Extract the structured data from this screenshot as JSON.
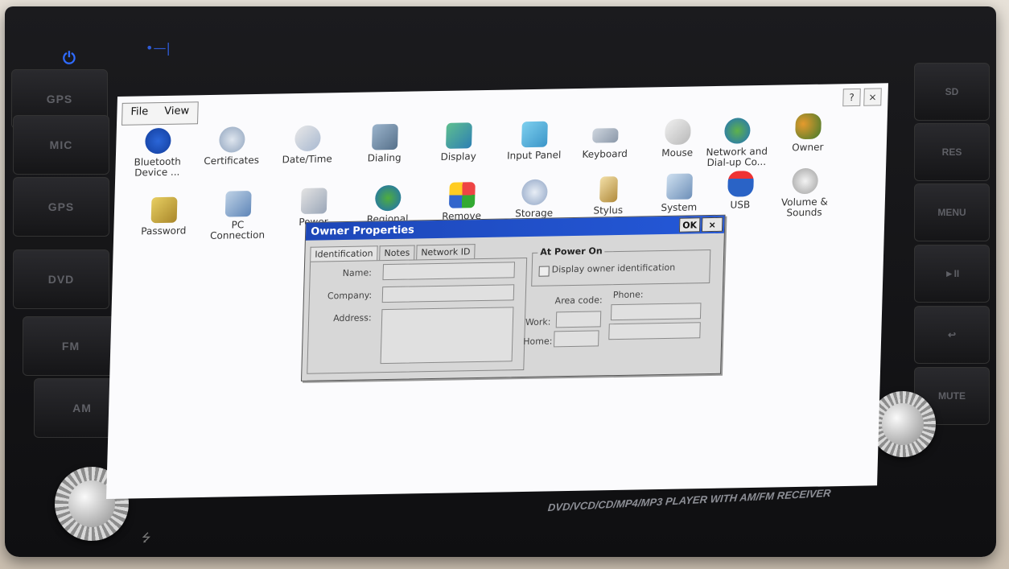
{
  "device": {
    "left_buttons": [
      "GPS",
      "MIC",
      "GPS",
      "DVD",
      "FM",
      "AM"
    ],
    "right_buttons": [
      "SD",
      "RES",
      "MENU",
      "►II",
      "↩",
      "MUTE"
    ],
    "silkscreen": "DVD/VCD/CD/MP4/MP3 PLAYER WITH AM/FM RECEIVER"
  },
  "window": {
    "menu": {
      "file": "File",
      "view": "View"
    },
    "help_btn": "?",
    "close_btn": "×"
  },
  "control_panel": {
    "row1": [
      "Bluetooth Device ...",
      "Certificates",
      "Date/Time",
      "Dialing",
      "Display",
      "Input Panel",
      "Keyboard",
      "Mouse",
      "Network and Dial-up Co...",
      "Owner"
    ],
    "row2": [
      "Password",
      "PC Connection",
      "Power",
      "Regional",
      "Remove",
      "Storage",
      "Stylus",
      "System",
      "USB",
      "Volume & Sounds"
    ]
  },
  "dialog": {
    "title": "Owner Properties",
    "ok": "OK",
    "close": "×",
    "tabs": [
      "Identification",
      "Notes",
      "Network ID"
    ],
    "labels": {
      "name": "Name:",
      "company": "Company:",
      "address": "Address:"
    },
    "power_group": {
      "title": "At Power On",
      "checkbox_label": "Display owner identification"
    },
    "phone": {
      "area_code": "Area code:",
      "phone": "Phone:",
      "work": "Work:",
      "home": "Home:"
    }
  },
  "colors": {
    "titlebar": "#1d47b8",
    "screen_bg": "#fbfbfd",
    "bezel": "#151517"
  }
}
